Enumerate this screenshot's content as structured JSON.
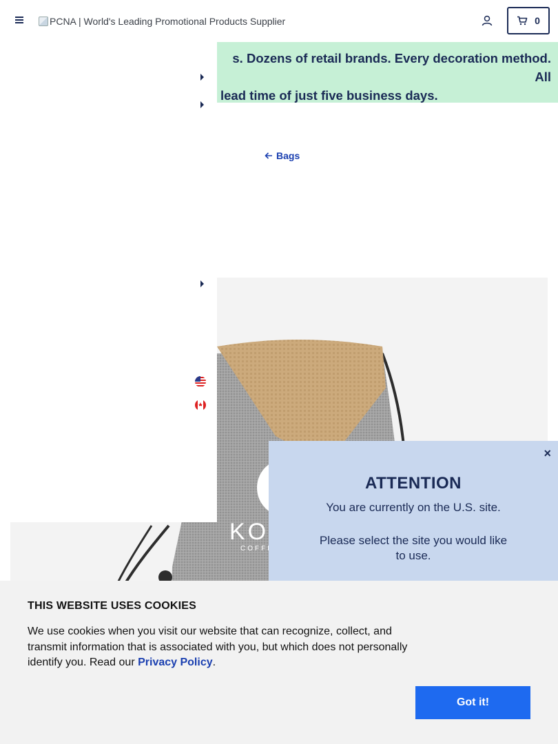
{
  "header": {
    "logo_alt": "PCNA | World's Leading Promotional Products Supplier",
    "cart_count": "0"
  },
  "banner": {
    "line1": "s. Dozens of retail brands. Every decoration method. All",
    "line2": "lead time of just five business days."
  },
  "breadcrumb": {
    "back_label": "Bags"
  },
  "attention_modal": {
    "close": "×",
    "title": "ATTENTION",
    "line1": "You are currently on the U.S. site.",
    "line2": "Please select the site you would like to use."
  },
  "cookie_banner": {
    "title": "THIS WEBSITE USES COOKIES",
    "body": "We use cookies when you visit our website that can recognize, collect, and transmit information that is associated with you, but which does not personally identify you. Read our ",
    "link": "Privacy Policy",
    "period": ".",
    "button": "Got it!"
  },
  "product": {
    "logo_text": "KO",
    "logo_sub": "COFFE"
  },
  "colors": {
    "navy": "#1a2a55",
    "link_blue": "#1a3fb0",
    "banner_green": "#c6f0d6",
    "modal_blue": "#c8d7ee",
    "button_blue": "#1e6af0"
  },
  "icons": [
    "hamburger-icon",
    "user-icon",
    "cart-icon",
    "caret-right-icon",
    "arrow-left-icon",
    "us-flag-icon",
    "canada-flag-icon",
    "close-icon"
  ]
}
